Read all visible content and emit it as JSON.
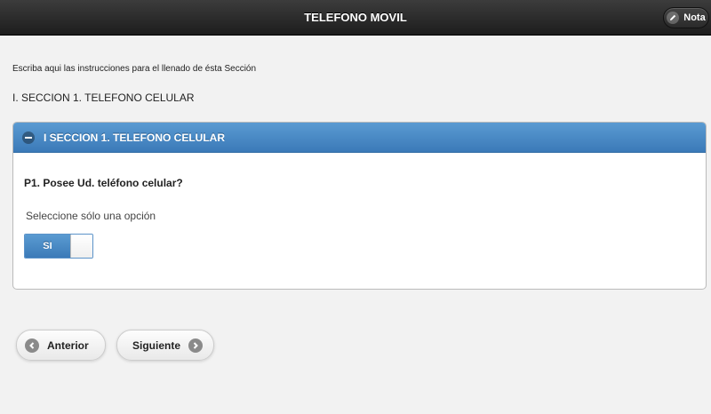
{
  "header": {
    "title": "TELEFONO MOVIL",
    "note_button_label": "Nota",
    "note_icon": "pencil-icon"
  },
  "page": {
    "instructions": "Escriba aqui las instrucciones para el llenado de ésta Sección",
    "section_title": "I. SECCION 1. TELEFONO CELULAR"
  },
  "panel": {
    "title": "I SECCION 1. TELEFONO CELULAR",
    "collapse_icon": "minus-icon",
    "question": "P1. Posee Ud. teléfono celular?",
    "hint": "Seleccione sólo una opción",
    "toggle": {
      "on_label": "SI",
      "state": "on",
      "accent": "#3b7ab8"
    }
  },
  "navigation": {
    "previous_label": "Anterior",
    "previous_icon": "arrow-left-icon",
    "next_label": "Siguiente",
    "next_icon": "arrow-right-icon"
  },
  "colors": {
    "header_bg": "#1d1d1d",
    "panel_header_bg": "#3b7ab8",
    "page_bg": "#f2f2f2"
  }
}
